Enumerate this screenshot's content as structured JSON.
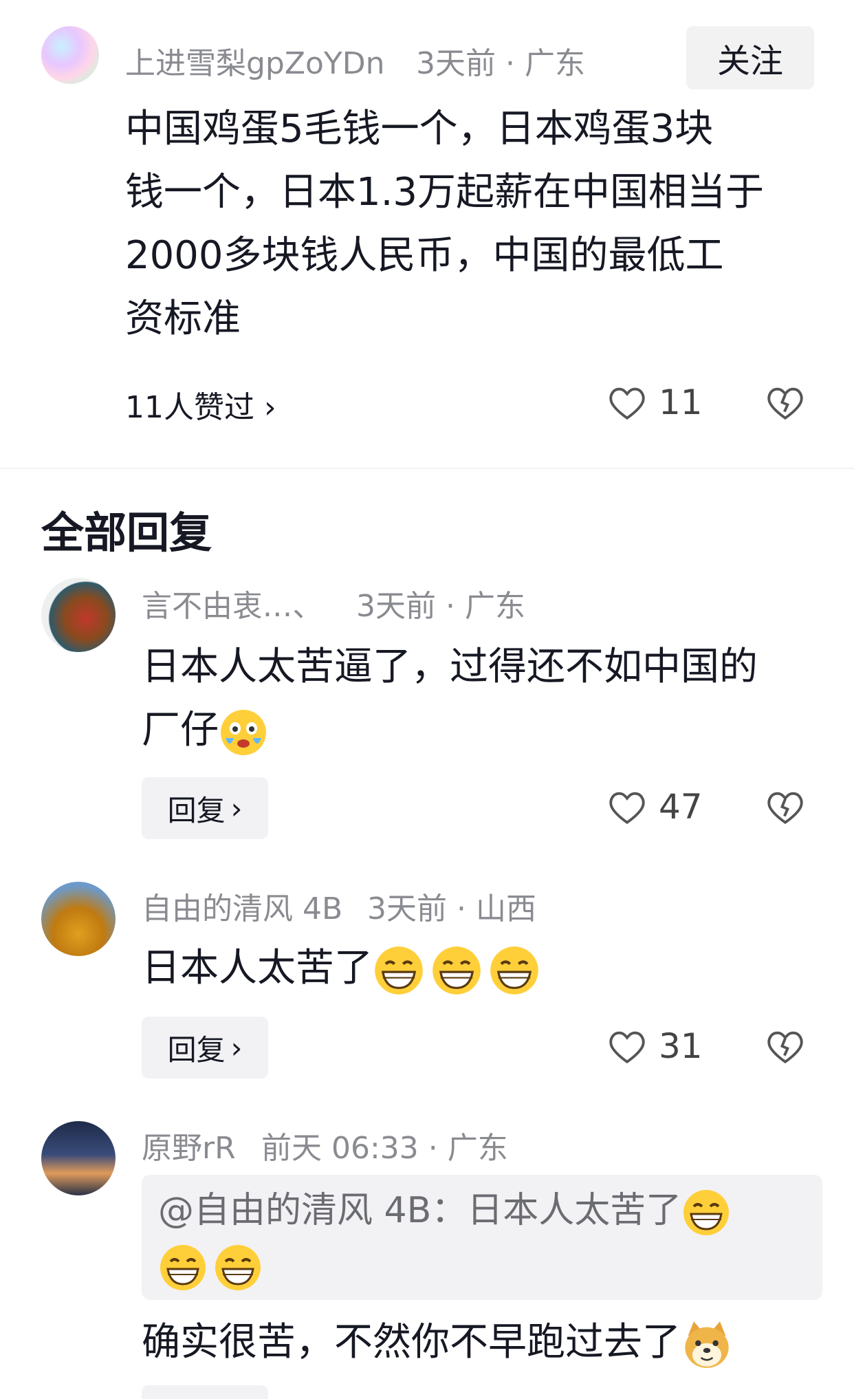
{
  "main_comment": {
    "username": "上进雪梨gpZoYDn",
    "time_location": "3天前 · 广东",
    "follow_label": "关注",
    "text_lines": [
      "中国鸡蛋5毛钱一个，日本鸡蛋3块",
      "钱一个，日本1.3万起薪在中国相当于",
      "2000多块钱人民币，中国的最低工",
      "资标准"
    ],
    "likers_label": "11人赞过 ›",
    "like_count": "11"
  },
  "replies_header": "全部回复",
  "replies": [
    {
      "username": "言不由衷.‥、",
      "time_location": "3天前 · 广东",
      "text_line1": "日本人太苦逼了，过得还不如中国的",
      "text_line2": "厂仔",
      "reply_label": "回复",
      "like_count": "47"
    },
    {
      "username": "自由的清风 4B",
      "time_location": "3天前 · 山西",
      "text": "日本人太苦了",
      "reply_label": "回复",
      "like_count": "31"
    },
    {
      "username": "原野rR",
      "time_location": "前天 06:33 · 广东",
      "quote_text": "@自由的清风 4B：日本人太苦了",
      "text": "确实很苦，不然你不早跑过去了"
    }
  ],
  "icons": {
    "like": "heart-outline-icon",
    "dislike": "broken-heart-icon",
    "cry": "crying-emoji-icon",
    "grin": "grinning-emoji-icon",
    "doge": "doge-emoji-icon"
  }
}
